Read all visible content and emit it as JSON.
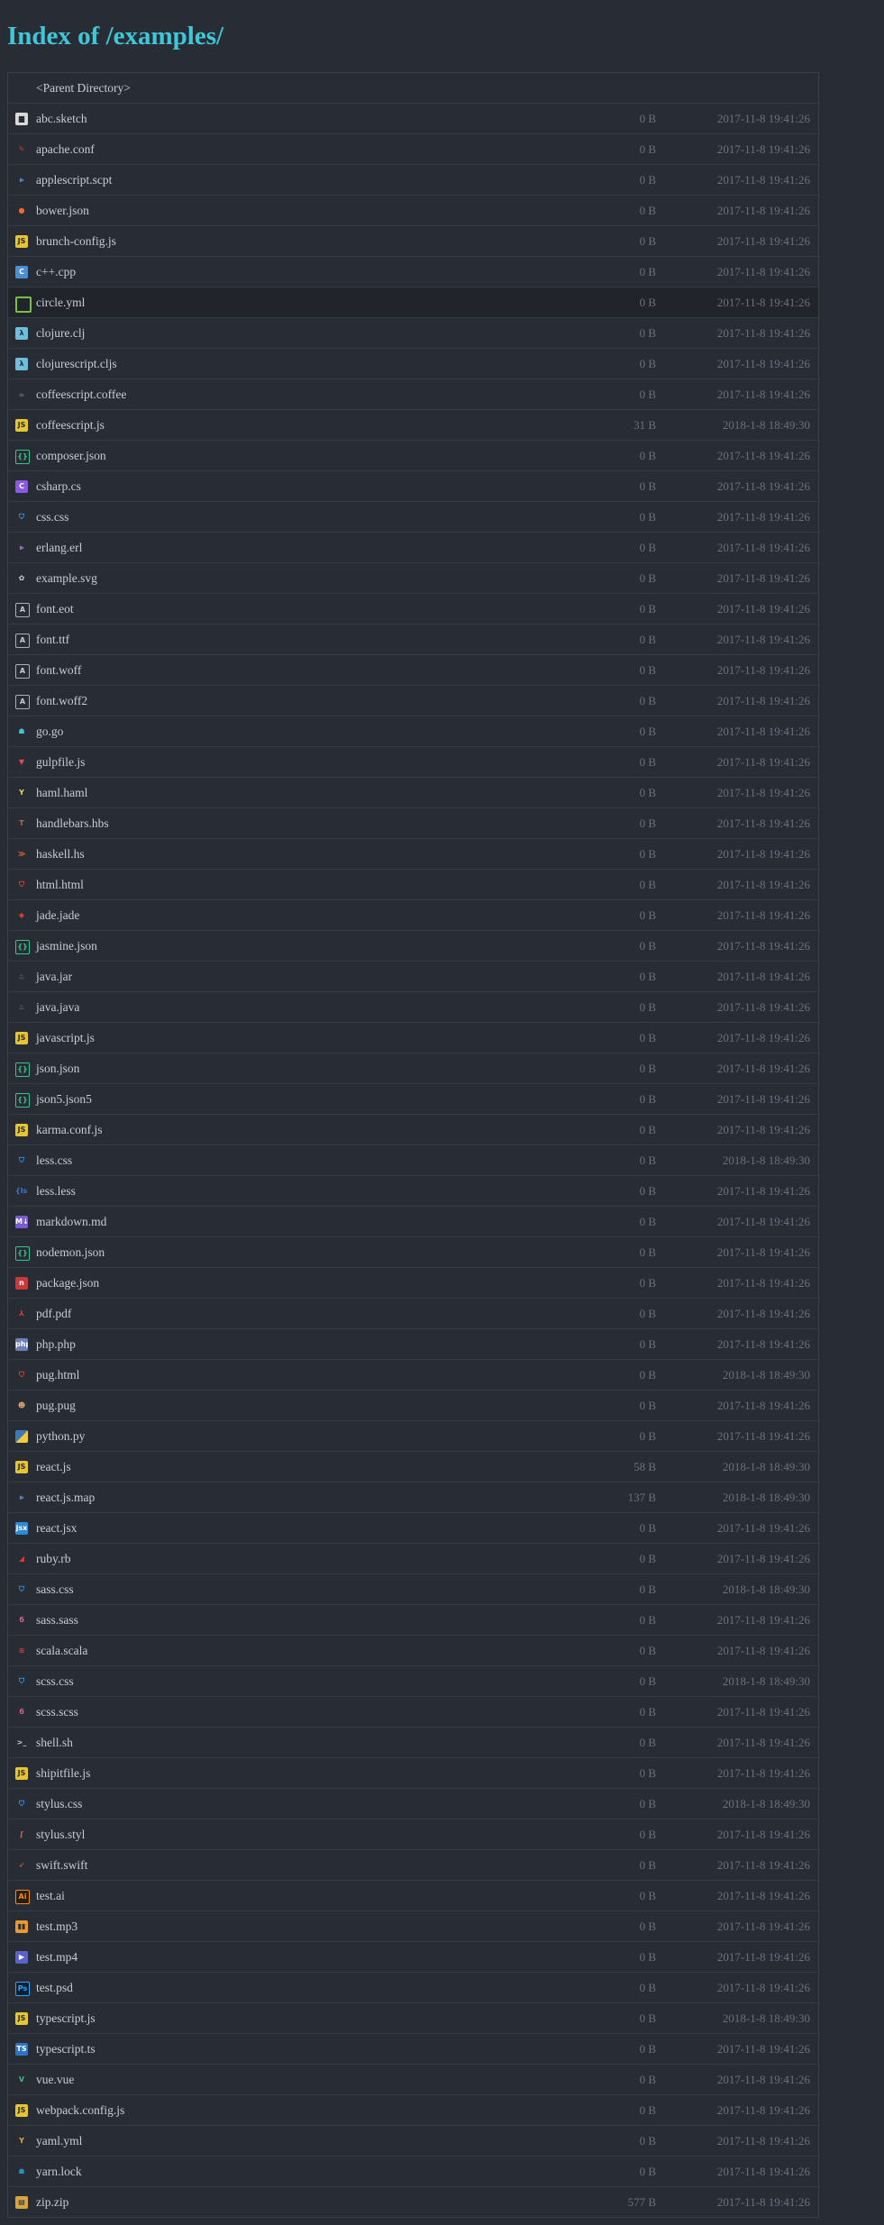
{
  "title": "Index of /examples/",
  "parent_label": "<Parent Directory>",
  "files": [
    {
      "name": "abc.sketch",
      "size": "0 B",
      "date": "2017-11-8 19:41:26",
      "icon": "sketch-icon",
      "glyph": "▆",
      "cls": "i-sketch"
    },
    {
      "name": "apache.conf",
      "size": "0 B",
      "date": "2017-11-8 19:41:26",
      "icon": "apache-feather-icon",
      "glyph": "✎",
      "cls": "i-apache"
    },
    {
      "name": "applescript.scpt",
      "size": "0 B",
      "date": "2017-11-8 19:41:26",
      "icon": "script-chevron-icon",
      "glyph": "⪢",
      "cls": "i-script"
    },
    {
      "name": "bower.json",
      "size": "0 B",
      "date": "2017-11-8 19:41:26",
      "icon": "bower-bird-icon",
      "glyph": "●",
      "cls": "i-bower"
    },
    {
      "name": "brunch-config.js",
      "size": "0 B",
      "date": "2017-11-8 19:41:26",
      "icon": "js-icon",
      "glyph": "JS",
      "cls": "i-js"
    },
    {
      "name": "c++.cpp",
      "size": "0 B",
      "date": "2017-11-8 19:41:26",
      "icon": "cpp-icon",
      "glyph": "C",
      "cls": "i-cpp"
    },
    {
      "name": "circle.yml",
      "size": "0 B",
      "date": "2017-11-8 19:41:26",
      "icon": "circleci-icon",
      "glyph": "",
      "cls": "i-circle",
      "highlight": true
    },
    {
      "name": "clojure.clj",
      "size": "0 B",
      "date": "2017-11-8 19:41:26",
      "icon": "clojure-icon",
      "glyph": "λ",
      "cls": "i-clojure"
    },
    {
      "name": "clojurescript.cljs",
      "size": "0 B",
      "date": "2017-11-8 19:41:26",
      "icon": "clojurescript-icon",
      "glyph": "λ",
      "cls": "i-clojure"
    },
    {
      "name": "coffeescript.coffee",
      "size": "0 B",
      "date": "2017-11-8 19:41:26",
      "icon": "coffee-cup-icon",
      "glyph": "☕",
      "cls": "i-coffee"
    },
    {
      "name": "coffeescript.js",
      "size": "31 B",
      "date": "2018-1-8 18:49:30",
      "icon": "js-icon",
      "glyph": "JS",
      "cls": "i-js"
    },
    {
      "name": "composer.json",
      "size": "0 B",
      "date": "2017-11-8 19:41:26",
      "icon": "json-icon",
      "glyph": "{}",
      "cls": "i-json"
    },
    {
      "name": "csharp.cs",
      "size": "0 B",
      "date": "2017-11-8 19:41:26",
      "icon": "csharp-icon",
      "glyph": "C",
      "cls": "i-csharp"
    },
    {
      "name": "css.css",
      "size": "0 B",
      "date": "2017-11-8 19:41:26",
      "icon": "css-shield-icon",
      "glyph": "⛉",
      "cls": "i-css"
    },
    {
      "name": "erlang.erl",
      "size": "0 B",
      "date": "2017-11-8 19:41:26",
      "icon": "erlang-icon",
      "glyph": "⪢",
      "cls": "i-erlang"
    },
    {
      "name": "example.svg",
      "size": "0 B",
      "date": "2017-11-8 19:41:26",
      "icon": "svg-icon",
      "glyph": "✿",
      "cls": "i-svg"
    },
    {
      "name": "font.eot",
      "size": "0 B",
      "date": "2017-11-8 19:41:26",
      "icon": "font-file-icon",
      "glyph": "A",
      "cls": "i-font"
    },
    {
      "name": "font.ttf",
      "size": "0 B",
      "date": "2017-11-8 19:41:26",
      "icon": "font-file-icon",
      "glyph": "A",
      "cls": "i-font"
    },
    {
      "name": "font.woff",
      "size": "0 B",
      "date": "2017-11-8 19:41:26",
      "icon": "font-file-icon",
      "glyph": "A",
      "cls": "i-font"
    },
    {
      "name": "font.woff2",
      "size": "0 B",
      "date": "2017-11-8 19:41:26",
      "icon": "font-file-icon",
      "glyph": "A",
      "cls": "i-font"
    },
    {
      "name": "go.go",
      "size": "0 B",
      "date": "2017-11-8 19:41:26",
      "icon": "go-gopher-icon",
      "glyph": "☗",
      "cls": "i-go"
    },
    {
      "name": "gulpfile.js",
      "size": "0 B",
      "date": "2017-11-8 19:41:26",
      "icon": "gulp-cup-icon",
      "glyph": "▼",
      "cls": "i-gulp"
    },
    {
      "name": "haml.haml",
      "size": "0 B",
      "date": "2017-11-8 19:41:26",
      "icon": "haml-icon",
      "glyph": "Y",
      "cls": "i-haml"
    },
    {
      "name": "handlebars.hbs",
      "size": "0 B",
      "date": "2017-11-8 19:41:26",
      "icon": "handlebars-icon",
      "glyph": "T",
      "cls": "i-hbs"
    },
    {
      "name": "haskell.hs",
      "size": "0 B",
      "date": "2017-11-8 19:41:26",
      "icon": "haskell-icon",
      "glyph": "≫",
      "cls": "i-haskell"
    },
    {
      "name": "html.html",
      "size": "0 B",
      "date": "2017-11-8 19:41:26",
      "icon": "html-shield-icon",
      "glyph": "⛉",
      "cls": "i-html"
    },
    {
      "name": "jade.jade",
      "size": "0 B",
      "date": "2017-11-8 19:41:26",
      "icon": "jade-icon",
      "glyph": "◆",
      "cls": "i-jade"
    },
    {
      "name": "jasmine.json",
      "size": "0 B",
      "date": "2017-11-8 19:41:26",
      "icon": "json-icon",
      "glyph": "{}",
      "cls": "i-json"
    },
    {
      "name": "java.jar",
      "size": "0 B",
      "date": "2017-11-8 19:41:26",
      "icon": "java-cup-icon",
      "glyph": "♨",
      "cls": "i-java"
    },
    {
      "name": "java.java",
      "size": "0 B",
      "date": "2017-11-8 19:41:26",
      "icon": "java-cup-icon",
      "glyph": "♨",
      "cls": "i-java"
    },
    {
      "name": "javascript.js",
      "size": "0 B",
      "date": "2017-11-8 19:41:26",
      "icon": "js-icon",
      "glyph": "JS",
      "cls": "i-js"
    },
    {
      "name": "json.json",
      "size": "0 B",
      "date": "2017-11-8 19:41:26",
      "icon": "json-icon",
      "glyph": "{}",
      "cls": "i-json"
    },
    {
      "name": "json5.json5",
      "size": "0 B",
      "date": "2017-11-8 19:41:26",
      "icon": "json-icon",
      "glyph": "{}",
      "cls": "i-json"
    },
    {
      "name": "karma.conf.js",
      "size": "0 B",
      "date": "2017-11-8 19:41:26",
      "icon": "js-icon",
      "glyph": "JS",
      "cls": "i-js"
    },
    {
      "name": "less.css",
      "size": "0 B",
      "date": "2018-1-8 18:49:30",
      "icon": "css-shield-icon",
      "glyph": "⛉",
      "cls": "i-css"
    },
    {
      "name": "less.less",
      "size": "0 B",
      "date": "2017-11-8 19:41:26",
      "icon": "less-icon",
      "glyph": "{ls}",
      "cls": "i-less"
    },
    {
      "name": "markdown.md",
      "size": "0 B",
      "date": "2017-11-8 19:41:26",
      "icon": "markdown-icon",
      "glyph": "M↓",
      "cls": "i-md"
    },
    {
      "name": "nodemon.json",
      "size": "0 B",
      "date": "2017-11-8 19:41:26",
      "icon": "json-icon",
      "glyph": "{}",
      "cls": "i-json"
    },
    {
      "name": "package.json",
      "size": "0 B",
      "date": "2017-11-8 19:41:26",
      "icon": "npm-icon",
      "glyph": "n",
      "cls": "i-npm"
    },
    {
      "name": "pdf.pdf",
      "size": "0 B",
      "date": "2017-11-8 19:41:26",
      "icon": "pdf-icon",
      "glyph": "⅄",
      "cls": "i-pdf"
    },
    {
      "name": "php.php",
      "size": "0 B",
      "date": "2017-11-8 19:41:26",
      "icon": "php-icon",
      "glyph": "php",
      "cls": "i-php"
    },
    {
      "name": "pug.html",
      "size": "0 B",
      "date": "2018-1-8 18:49:30",
      "icon": "html-shield-icon",
      "glyph": "⛉",
      "cls": "i-html"
    },
    {
      "name": "pug.pug",
      "size": "0 B",
      "date": "2017-11-8 19:41:26",
      "icon": "pug-dog-icon",
      "glyph": "☻",
      "cls": "i-pug"
    },
    {
      "name": "python.py",
      "size": "0 B",
      "date": "2017-11-8 19:41:26",
      "icon": "python-icon",
      "glyph": "",
      "cls": "i-python"
    },
    {
      "name": "react.js",
      "size": "58 B",
      "date": "2018-1-8 18:49:30",
      "icon": "js-icon",
      "glyph": "JS",
      "cls": "i-js"
    },
    {
      "name": "react.js.map",
      "size": "137 B",
      "date": "2018-1-8 18:49:30",
      "icon": "map-chevron-icon",
      "glyph": "⪢",
      "cls": "i-script"
    },
    {
      "name": "react.jsx",
      "size": "0 B",
      "date": "2017-11-8 19:41:26",
      "icon": "jsx-icon",
      "glyph": "jsx",
      "cls": "i-react"
    },
    {
      "name": "ruby.rb",
      "size": "0 B",
      "date": "2017-11-8 19:41:26",
      "icon": "ruby-icon",
      "glyph": "◢",
      "cls": "i-ruby"
    },
    {
      "name": "sass.css",
      "size": "0 B",
      "date": "2018-1-8 18:49:30",
      "icon": "css-shield-icon",
      "glyph": "⛉",
      "cls": "i-css"
    },
    {
      "name": "sass.sass",
      "size": "0 B",
      "date": "2017-11-8 19:41:26",
      "icon": "sass-icon",
      "glyph": "ϭ",
      "cls": "i-sass"
    },
    {
      "name": "scala.scala",
      "size": "0 B",
      "date": "2017-11-8 19:41:26",
      "icon": "scala-icon",
      "glyph": "≋",
      "cls": "i-scala"
    },
    {
      "name": "scss.css",
      "size": "0 B",
      "date": "2018-1-8 18:49:30",
      "icon": "css-shield-icon",
      "glyph": "⛉",
      "cls": "i-css"
    },
    {
      "name": "scss.scss",
      "size": "0 B",
      "date": "2017-11-8 19:41:26",
      "icon": "sass-icon",
      "glyph": "ϭ",
      "cls": "i-sass"
    },
    {
      "name": "shell.sh",
      "size": "0 B",
      "date": "2017-11-8 19:41:26",
      "icon": "terminal-icon",
      "glyph": ">_",
      "cls": "i-shell"
    },
    {
      "name": "shipitfile.js",
      "size": "0 B",
      "date": "2017-11-8 19:41:26",
      "icon": "js-icon",
      "glyph": "JS",
      "cls": "i-js"
    },
    {
      "name": "stylus.css",
      "size": "0 B",
      "date": "2018-1-8 18:49:30",
      "icon": "css-shield-icon",
      "glyph": "⛉",
      "cls": "i-css"
    },
    {
      "name": "stylus.styl",
      "size": "0 B",
      "date": "2017-11-8 19:41:26",
      "icon": "stylus-icon",
      "glyph": "ʃ",
      "cls": "i-stylus"
    },
    {
      "name": "swift.swift",
      "size": "0 B",
      "date": "2017-11-8 19:41:26",
      "icon": "swift-bird-icon",
      "glyph": "➶",
      "cls": "i-swift"
    },
    {
      "name": "test.ai",
      "size": "0 B",
      "date": "2017-11-8 19:41:26",
      "icon": "illustrator-icon",
      "glyph": "Ai",
      "cls": "i-ai"
    },
    {
      "name": "test.mp3",
      "size": "0 B",
      "date": "2017-11-8 19:41:26",
      "icon": "audio-icon",
      "glyph": "▮▮",
      "cls": "i-mp3"
    },
    {
      "name": "test.mp4",
      "size": "0 B",
      "date": "2017-11-8 19:41:26",
      "icon": "video-icon",
      "glyph": "▶",
      "cls": "i-mp4"
    },
    {
      "name": "test.psd",
      "size": "0 B",
      "date": "2017-11-8 19:41:26",
      "icon": "photoshop-icon",
      "glyph": "Ps",
      "cls": "i-psd"
    },
    {
      "name": "typescript.js",
      "size": "0 B",
      "date": "2018-1-8 18:49:30",
      "icon": "js-icon",
      "glyph": "JS",
      "cls": "i-js"
    },
    {
      "name": "typescript.ts",
      "size": "0 B",
      "date": "2017-11-8 19:41:26",
      "icon": "ts-icon",
      "glyph": "TS",
      "cls": "i-ts"
    },
    {
      "name": "vue.vue",
      "size": "0 B",
      "date": "2017-11-8 19:41:26",
      "icon": "vue-icon",
      "glyph": "V",
      "cls": "i-vue"
    },
    {
      "name": "webpack.config.js",
      "size": "0 B",
      "date": "2017-11-8 19:41:26",
      "icon": "js-icon",
      "glyph": "JS",
      "cls": "i-js"
    },
    {
      "name": "yaml.yml",
      "size": "0 B",
      "date": "2017-11-8 19:41:26",
      "icon": "yaml-icon",
      "glyph": "Y",
      "cls": "i-yaml"
    },
    {
      "name": "yarn.lock",
      "size": "0 B",
      "date": "2017-11-8 19:41:26",
      "icon": "yarn-cat-icon",
      "glyph": "☗",
      "cls": "i-yarn"
    },
    {
      "name": "zip.zip",
      "size": "577 B",
      "date": "2017-11-8 19:41:26",
      "icon": "zip-archive-icon",
      "glyph": "▤",
      "cls": "i-zip"
    }
  ]
}
